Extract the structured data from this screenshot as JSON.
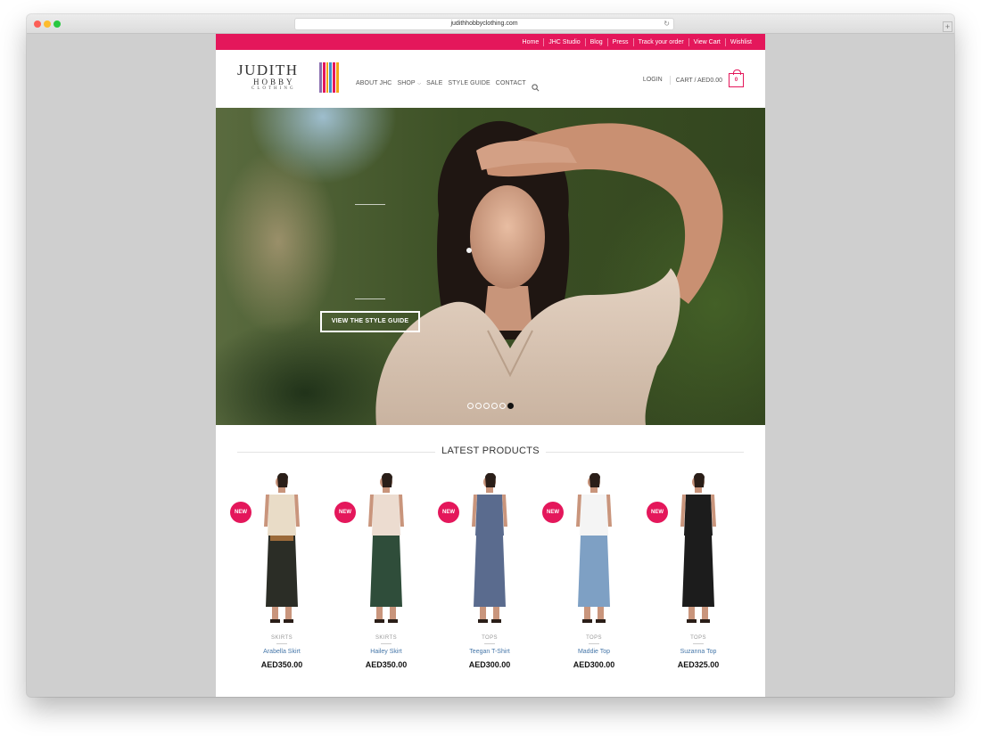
{
  "browser": {
    "url": "judithhobbyclothing.com",
    "new_tab_label": "+"
  },
  "topbar": {
    "links": [
      "Home",
      "JHC Studio",
      "Blog",
      "Press",
      "Track your order",
      "View Cart",
      "Wishlist"
    ]
  },
  "logo": {
    "name": "JUDITH",
    "line2": "HOBBY",
    "line3": "CLOTHING",
    "stripe_colors": [
      "#8a6fb0",
      "#e4175b",
      "#f2a516",
      "#3f8fcf",
      "#e4175b",
      "#f2a516"
    ]
  },
  "nav": {
    "about": "ABOUT JHC",
    "shop": "SHOP",
    "sale": "SALE",
    "style_guide": "STYLE GUIDE",
    "contact": "CONTACT"
  },
  "account": {
    "login": "LOGIN",
    "cart_label": "CART / AED0.00",
    "cart_count": "0"
  },
  "hero": {
    "button": "VIEW THE STYLE GUIDE",
    "slide_count": 6,
    "active_slide": 6
  },
  "latest": {
    "title": "LATEST PRODUCTS",
    "products": [
      {
        "badge": "NEW",
        "category": "SKIRTS",
        "name": "Arabella Skirt",
        "price": "AED350.00",
        "top_color": "#e9dcc7",
        "bottom_color": "#2b2d26",
        "belt": true
      },
      {
        "badge": "NEW",
        "category": "SKIRTS",
        "name": "Hailey Skirt",
        "price": "AED350.00",
        "top_color": "#ecdcd0",
        "bottom_color": "#2f4d3a",
        "belt": false
      },
      {
        "badge": "NEW",
        "category": "TOPS",
        "name": "Teegan T-Shirt",
        "price": "AED300.00",
        "top_color": "#5a6b8e",
        "bottom_color": "#5a6b8e",
        "belt": false
      },
      {
        "badge": "NEW",
        "category": "TOPS",
        "name": "Maddie Top",
        "price": "AED300.00",
        "top_color": "#f4f4f4",
        "bottom_color": "#7ea0c4",
        "belt": false
      },
      {
        "badge": "NEW",
        "category": "TOPS",
        "name": "Suzanna Top",
        "price": "AED325.00",
        "top_color": "#1c1c1c",
        "bottom_color": "#1c1c1c",
        "belt": false
      }
    ]
  }
}
